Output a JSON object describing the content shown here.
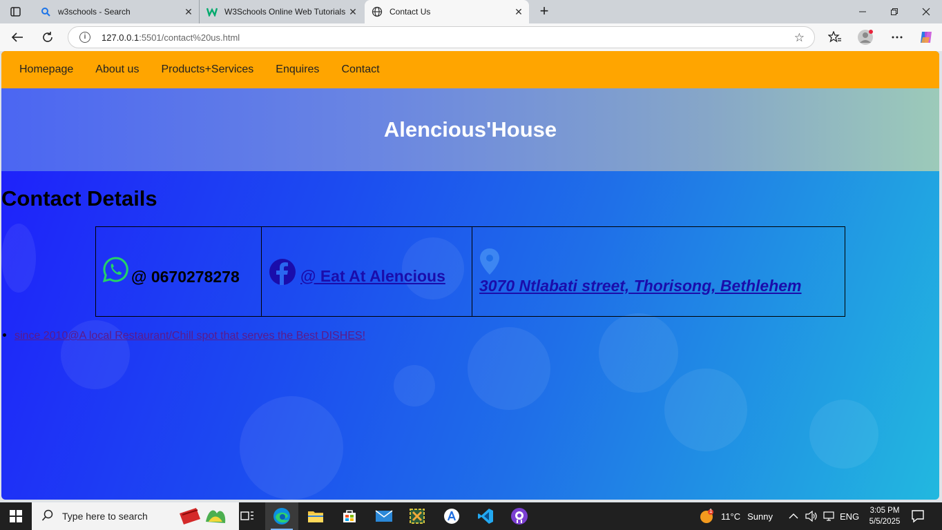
{
  "browser": {
    "tabs": [
      {
        "title": "w3schools - Search",
        "icon": "search-icon"
      },
      {
        "title": "W3Schools Online Web Tutorials",
        "icon": "w3schools-icon"
      },
      {
        "title": "Contact Us",
        "icon": "globe-icon",
        "active": true
      }
    ],
    "url_host": "127.0.0.1",
    "url_path": ":5501/contact%20us.html"
  },
  "page": {
    "nav": [
      "Homepage",
      "About us",
      "Products+Services",
      "Enquires",
      "Contact"
    ],
    "site_title": "Alencious'House",
    "contact_heading": "Contact Details",
    "contacts": {
      "phone": "@ 0670278278",
      "facebook": "@ Eat At Alencious",
      "address": "3070 Ntlabati street, Thorisong, Bethlehem"
    },
    "tagline": "since 2010@A local Restaurant/Chill spot that serves the Best DISHES!",
    "colors": {
      "nav_bg": "#ffa500",
      "link": "#1a0dab",
      "whatsapp": "#25d366"
    }
  },
  "taskbar": {
    "search_placeholder": "Type here to search",
    "weather_temp": "11°C",
    "weather_desc": "Sunny",
    "language": "ENG",
    "time": "3:05 PM",
    "date": "5/5/2025",
    "weather_badge": "1"
  }
}
